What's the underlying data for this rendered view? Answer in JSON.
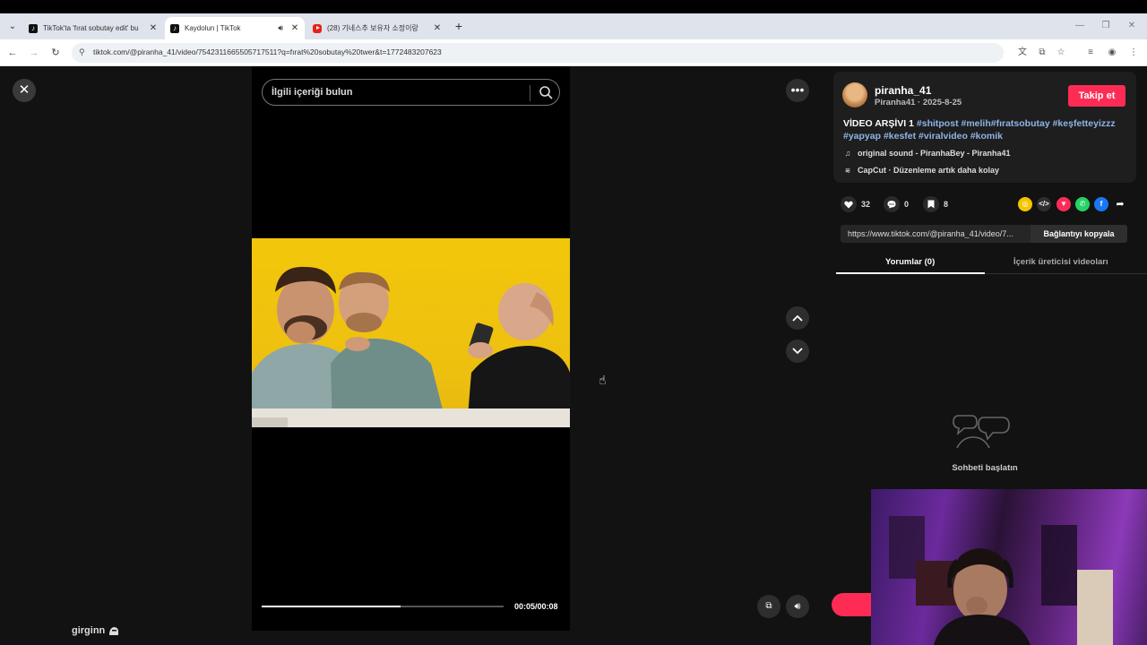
{
  "browser": {
    "tabs": [
      {
        "title": "TikTok'ta 'fırat sobutay edit' bu",
        "favicon": "tiktok-icon"
      },
      {
        "title": "Kaydolun | TikTok",
        "favicon": "tiktok-icon",
        "active": true,
        "audio": true
      },
      {
        "title": "(28) 기네스추 보유자 소정이랑",
        "favicon": "youtube-icon"
      }
    ],
    "url": "tiktok.com/@piranha_41/video/7542311665505717511?q=fırat%20sobutay%20twer&t=1772483207623"
  },
  "player": {
    "search_placeholder": "İlgili içeriği bulun",
    "time": "00:05/00:08",
    "progress": 0.575,
    "watermark": "girginn"
  },
  "post": {
    "username": "piranha_41",
    "subline": "Piranha41 · 2025-8-25",
    "follow_label": "Takip et",
    "desc_text": "VİDEO ARŞİVI 1",
    "hashtags_line1": "#shitpost #melih#fıratsobutay #keşfetteyizzz",
    "hashtags_line2": "#yapyap #kesfet #viralvideo #komik",
    "sound": "original sound - PiranhaBey - Piranha41",
    "capcut": "CapCut · Düzenleme artık daha kolay",
    "likes": "32",
    "comments": "0",
    "saves": "8",
    "link": "https://www.tiktok.com/@piranha_41/video/7...",
    "copy_label": "Bağlantıyı kopyala",
    "tab_comments": "Yorumlar (0)",
    "tab_creator": "İçerik üreticisi videoları",
    "empty_text": "Sohbeti başlatın"
  },
  "colors": {
    "accent": "#fe2c55",
    "hashtag": "#8fb4e8"
  }
}
